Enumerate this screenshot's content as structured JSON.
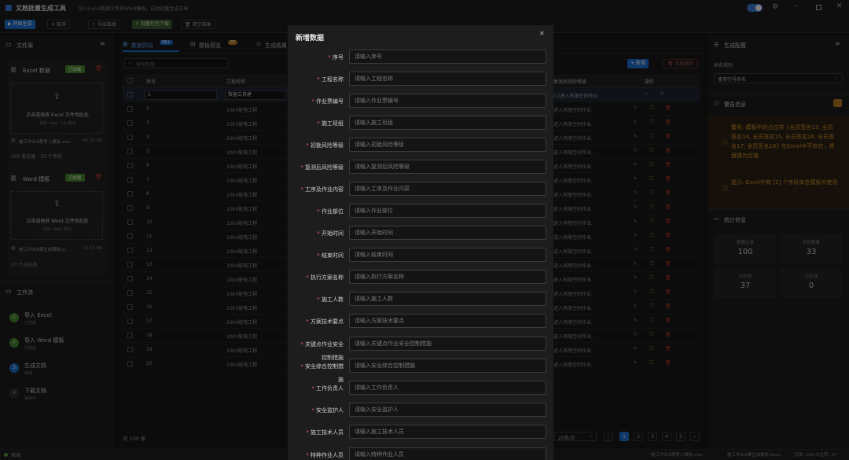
{
  "app": {
    "title": "文档批量生成工具",
    "subtitle": "导入Excel数据文件和Word模板，自动批量生成文档"
  },
  "toolbar": {
    "start": "开始生成",
    "cancel": "取消",
    "export": "导出数据",
    "batch_download": "批量打包下载",
    "clear": "清空结果"
  },
  "left": {
    "files_title": "文件源",
    "excel": {
      "title": "Excel 数据",
      "badge": "已加载",
      "drop_text": "点击或拖放 Excel 文件到此处",
      "drop_hint": "支持 .xlsx, .xls 格式",
      "file_name": "施工作业A票导入模板.xlsx",
      "file_size": "66.78 KB",
      "meta": "100 条记录　33 个字段"
    },
    "word": {
      "title": "Word 模板",
      "badge": "已加载",
      "drop_text": "点击或拖放 Word 文件到此处",
      "drop_hint": "支持 .docx 格式",
      "file_name": "施工作业A票生成模板.d...",
      "file_size": "19.67 KB",
      "meta": "37 个占位符"
    },
    "workflow_title": "工作流",
    "steps": [
      {
        "num": "✓",
        "title": "导入 Excel",
        "sub": "已完成"
      },
      {
        "num": "✓",
        "title": "导入 Word 模板",
        "sub": "已完成"
      },
      {
        "num": "3",
        "title": "生成文档",
        "sub": "就绪"
      },
      {
        "num": "4",
        "title": "下载文档",
        "sub": "等待中"
      }
    ]
  },
  "center": {
    "tabs": [
      {
        "label": "数据预览",
        "badge": "99+"
      },
      {
        "label": "模板预览",
        "badge": "37"
      },
      {
        "label": "生成结果",
        "badge": ""
      }
    ],
    "search_placeholder": "搜索数据",
    "add_label": "+ 新增",
    "batch_delete_label": "批量删除",
    "headers": {
      "index": "序号",
      "project": "工程名称",
      "risk": "复测后风险等级",
      "ops": "操作"
    },
    "first_row": {
      "index": "1",
      "project": "数据工具建",
      "risk": "(1)进入有限空间作业"
    },
    "rows": [
      {
        "index": "2",
        "project": "10kV配电工程",
        "risk": "进入有限空间作业,"
      },
      {
        "index": "3",
        "project": "10kV配电工程",
        "risk": "进入有限空间作业,"
      },
      {
        "index": "4",
        "project": "10kV配电工程",
        "risk": "进入有限空间作业,"
      },
      {
        "index": "5",
        "project": "10kV配电工程",
        "risk": "进入有限空间作业,"
      },
      {
        "index": "6",
        "project": "10kV配电工程",
        "risk": "进入有限空间作业,"
      },
      {
        "index": "7",
        "project": "10kV配电工程",
        "risk": "进入有限空间作业,"
      },
      {
        "index": "8",
        "project": "10kV配电工程",
        "risk": "进入有限空间作业,"
      },
      {
        "index": "9",
        "project": "10kV配电工程",
        "risk": "进入有限空间作业,"
      },
      {
        "index": "10",
        "project": "10kV配电工程",
        "risk": "进入有限空间作业,"
      },
      {
        "index": "11",
        "project": "10kV配电工程",
        "risk": "进入有限空间作业,"
      },
      {
        "index": "12",
        "project": "10kV配电工程",
        "risk": "进入有限空间作业,"
      },
      {
        "index": "13",
        "project": "10kV配电工程",
        "risk": "进入有限空间作业,"
      },
      {
        "index": "14",
        "project": "10kV配电工程",
        "risk": "进入有限空间作业,"
      },
      {
        "index": "15",
        "project": "10kV配电工程",
        "risk": "进入有限空间作业,"
      },
      {
        "index": "16",
        "project": "10kV配电工程",
        "risk": "进入有限空间作业,"
      },
      {
        "index": "17",
        "project": "10kV配电工程",
        "risk": "进入有限空间作业,"
      },
      {
        "index": "18",
        "project": "10kV配电工程",
        "risk": "进入有限空间作业,"
      },
      {
        "index": "19",
        "project": "10kV配电工程",
        "risk": "进入有限空间作业,"
      },
      {
        "index": "20",
        "project": "10kV配电工程",
        "risk": "进入有限空间作业,"
      }
    ],
    "total": "共 100 条",
    "page_size": "20条/页",
    "pages": [
      "1",
      "2",
      "3",
      "4",
      "5"
    ]
  },
  "right": {
    "config_title": "生成配置",
    "naming_label": "命名规则",
    "naming_value": "使用行号命名",
    "warning_title": "警告信息",
    "warning_1": "警告: 模板中的占位符 {全员签名13, 全员签名14, 全员签名15, 全员签名16, 全员签名17, 全员签名18} 在Excel中不存在，将替换为空值",
    "warning_2": "提示: Excel中有 [2] 个字段未在模板中使用",
    "stats_title": "统计信息",
    "stats": [
      {
        "label": "数据记录",
        "value": "100"
      },
      {
        "label": "字段数量",
        "value": "33"
      },
      {
        "label": "占位符",
        "value": "37"
      },
      {
        "label": "已生成",
        "value": "0"
      }
    ]
  },
  "modal": {
    "title": "新增数据",
    "fields": [
      {
        "label": "序号",
        "placeholder": "请输入序号"
      },
      {
        "label": "工程名称",
        "placeholder": "请输入工程名称"
      },
      {
        "label": "作业票编号",
        "placeholder": "请输入作业票编号"
      },
      {
        "label": "施工班组",
        "placeholder": "请输入施工班组"
      },
      {
        "label": "初勘风险等级",
        "placeholder": "请输入初勘风险等级"
      },
      {
        "label": "复测后风险等级",
        "placeholder": "请输入复测后风险等级"
      },
      {
        "label": "工序及作业内容",
        "placeholder": "请输入工序及作业内容"
      },
      {
        "label": "作业部位",
        "placeholder": "请输入作业部位"
      },
      {
        "label": "开始时间",
        "placeholder": "请输入开始时间"
      },
      {
        "label": "结束时间",
        "placeholder": "请输入结束时间"
      },
      {
        "label": "执行方案名称",
        "placeholder": "请输入执行方案名称"
      },
      {
        "label": "施工人数",
        "placeholder": "请输入施工人数"
      },
      {
        "label": "方案技术要点",
        "placeholder": "请输入方案技术要点"
      },
      {
        "label": "关键点作业安全",
        "placeholder": "请输入关键点作业安全控制措施"
      },
      {
        "label": "控制措施",
        "placeholder": ""
      },
      {
        "label": "安全综合控制措",
        "placeholder": "请输入安全综合控制措施"
      },
      {
        "label": "施",
        "placeholder": ""
      },
      {
        "label": "工作负责人",
        "placeholder": "请输入工作负责人"
      },
      {
        "label": "安全监护人",
        "placeholder": "请输入安全监护人"
      },
      {
        "label": "施工技术人员",
        "placeholder": "请输入施工技术人员"
      },
      {
        "label": "特种作业人员",
        "placeholder": "请输入特种作业人员"
      }
    ]
  },
  "status": {
    "left": "就绪",
    "file1": "施工作业A票导入模板.xlsx",
    "file2": "施工作业A票生成模板.docx",
    "counts": "记录: 100 占位符: 37"
  },
  "colors": {
    "accent": "#1f6fd1",
    "success": "#5aa03c",
    "warning": "#d4922a",
    "danger": "#c0392b"
  }
}
